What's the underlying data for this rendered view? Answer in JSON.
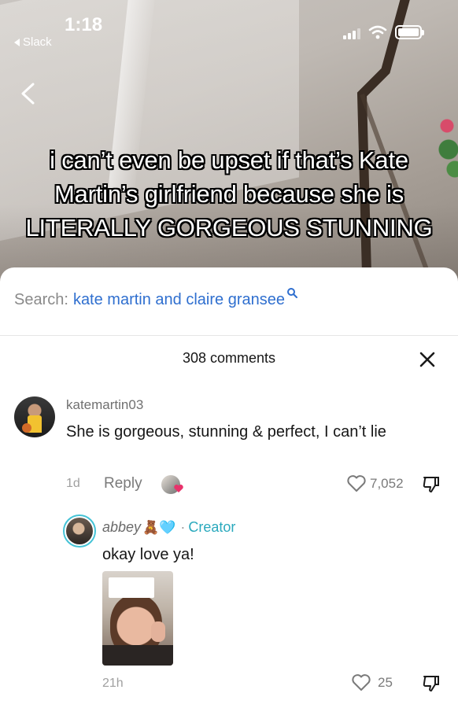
{
  "status_bar": {
    "time": "1:18",
    "back_app": "Slack"
  },
  "video": {
    "caption": "i can’t even be upset if that’s Kate Martin’s girlfriend because she is LITERALLY GORGEOUS STUNNING"
  },
  "search": {
    "label": "Search:",
    "query": "kate martin and claire gransee"
  },
  "comments_header": {
    "count": "308 comments"
  },
  "comment": {
    "username": "katemartin03",
    "text": "She is gorgeous, stunning & perfect, I can’t lie",
    "age": "1d",
    "reply_label": "Reply",
    "likes": "7,052"
  },
  "reply": {
    "username": "abbey",
    "emoji": "🧸🩵",
    "separator": "·",
    "badge": "Creator",
    "text": "okay love ya!",
    "age": "21h",
    "likes": "25"
  },
  "colors": {
    "link_blue": "#2f6fcf",
    "creator_teal": "#2aa9bd",
    "liked_heart": "#e8326b"
  }
}
